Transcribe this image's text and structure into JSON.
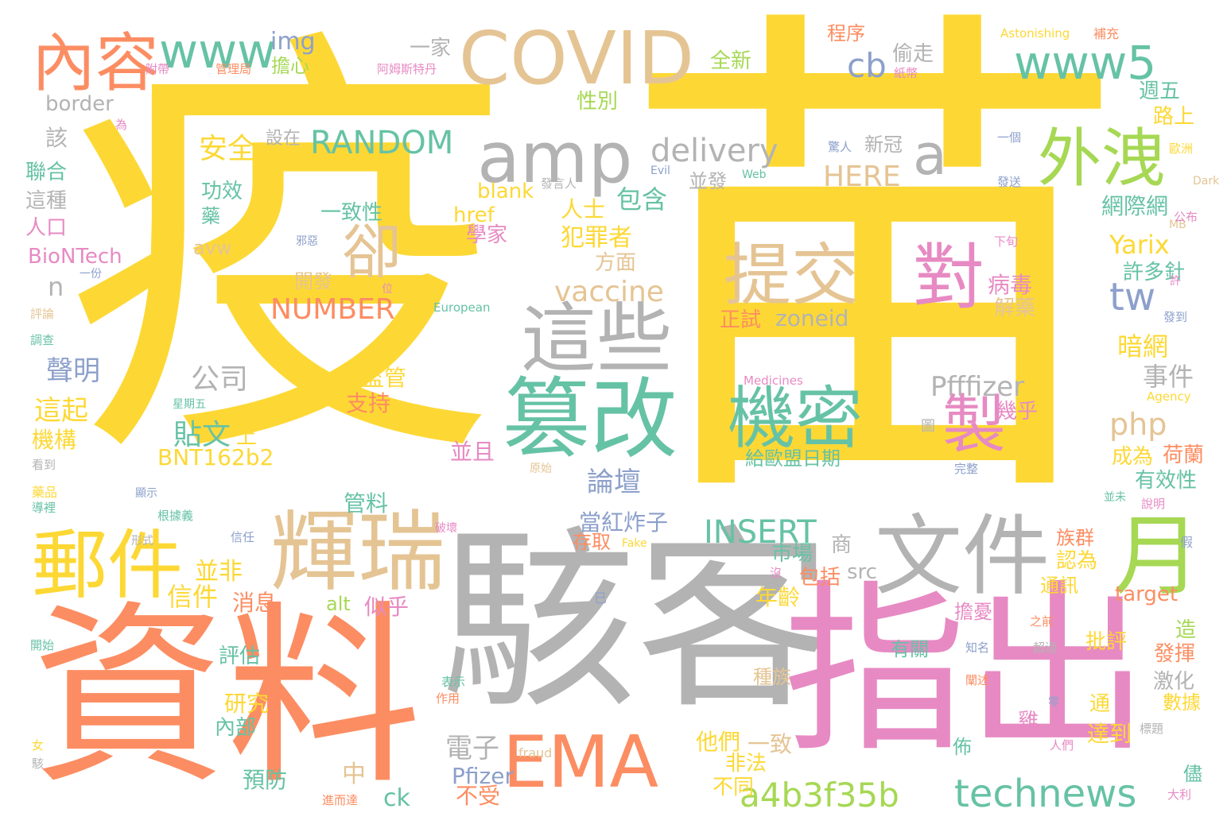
{
  "palette": {
    "yellow": "#FDD835",
    "orange": "#FC8D62",
    "gray": "#B3B3B3",
    "pink": "#E78AC3",
    "tan": "#E5C494",
    "green": "#66C2A5",
    "lime": "#A6D854",
    "blue": "#8DA0CB"
  },
  "words": [
    {
      "text": "疫",
      "color": "yellow"
    },
    {
      "text": "苗",
      "color": "yellow"
    },
    {
      "text": "資料",
      "color": "orange"
    },
    {
      "text": "駭客",
      "color": "gray"
    },
    {
      "text": "指出",
      "color": "pink"
    },
    {
      "text": "COVID",
      "color": "tan"
    },
    {
      "text": "EMA",
      "color": "orange"
    },
    {
      "text": "amp",
      "color": "gray"
    },
    {
      "text": "文件",
      "color": "gray"
    },
    {
      "text": "輝瑞",
      "color": "tan"
    },
    {
      "text": "篡改",
      "color": "green"
    },
    {
      "text": "這些",
      "color": "gray"
    },
    {
      "text": "郵件",
      "color": "yellow"
    },
    {
      "text": "內容",
      "color": "orange"
    },
    {
      "text": "www5",
      "color": "green"
    },
    {
      "text": "外洩",
      "color": "lime"
    },
    {
      "text": "月",
      "color": "lime"
    },
    {
      "text": "www",
      "color": "green"
    },
    {
      "text": "technews",
      "color": "green"
    },
    {
      "text": "a4b3f35b",
      "color": "lime"
    },
    {
      "text": "提交",
      "color": "tan"
    },
    {
      "text": "對",
      "color": "pink"
    },
    {
      "text": "機密",
      "color": "green"
    },
    {
      "text": "製",
      "color": "pink"
    },
    {
      "text": "卻",
      "color": "tan"
    },
    {
      "text": "RANDOM",
      "color": "green"
    },
    {
      "text": "delivery",
      "color": "gray"
    },
    {
      "text": "a",
      "color": "gray"
    },
    {
      "text": "cb",
      "color": "blue"
    },
    {
      "text": "tw",
      "color": "blue"
    },
    {
      "text": "NUMBER",
      "color": "orange"
    },
    {
      "text": "vaccine",
      "color": "tan"
    },
    {
      "text": "INSERT",
      "color": "green"
    },
    {
      "text": "Pfffizer",
      "color": "gray"
    },
    {
      "text": "php",
      "color": "tan"
    },
    {
      "text": "HERE",
      "color": "tan"
    },
    {
      "text": "Yarix",
      "color": "yellow"
    },
    {
      "text": "BNT162b2",
      "color": "yellow"
    },
    {
      "text": "zoneid",
      "color": "gray"
    },
    {
      "text": "blank",
      "color": "yellow"
    },
    {
      "text": "href",
      "color": "yellow"
    },
    {
      "text": "src",
      "color": "gray"
    },
    {
      "text": "alt",
      "color": "lime"
    },
    {
      "text": "target",
      "color": "orange"
    },
    {
      "text": "Pfizer",
      "color": "blue"
    },
    {
      "text": "ck",
      "color": "green"
    },
    {
      "text": "border",
      "color": "gray"
    },
    {
      "text": "img",
      "color": "blue"
    },
    {
      "text": "avw",
      "color": "tan"
    },
    {
      "text": "n",
      "color": "gray"
    },
    {
      "text": "BioNTech",
      "color": "pink"
    },
    {
      "text": "Astonishing",
      "color": "yellow"
    },
    {
      "text": "European",
      "color": "green"
    },
    {
      "text": "Medicines",
      "color": "pink"
    },
    {
      "text": "Agency",
      "color": "yellow"
    },
    {
      "text": "Web",
      "color": "green"
    },
    {
      "text": "Dark",
      "color": "tan"
    },
    {
      "text": "Evil",
      "color": "blue"
    },
    {
      "text": "MB",
      "color": "tan"
    },
    {
      "text": "Fake",
      "color": "yellow"
    },
    {
      "text": "fraud",
      "color": "tan"
    },
    {
      "text": "安全",
      "color": "yellow"
    },
    {
      "text": "外部",
      "color": "gray"
    },
    {
      "text": "聲明",
      "color": "blue"
    },
    {
      "text": "這起",
      "color": "yellow"
    },
    {
      "text": "機構",
      "color": "yellow"
    },
    {
      "text": "公司",
      "color": "gray"
    },
    {
      "text": "貼文",
      "color": "green"
    },
    {
      "text": "信件",
      "color": "yellow"
    },
    {
      "text": "並非",
      "color": "yellow"
    },
    {
      "text": "消息",
      "color": "orange"
    },
    {
      "text": "論壇",
      "color": "blue"
    },
    {
      "text": "當紅炸子",
      "color": "blue"
    },
    {
      "text": "市場",
      "color": "green"
    },
    {
      "text": "包括",
      "color": "orange"
    },
    {
      "text": "似乎",
      "color": "pink"
    },
    {
      "text": "年齡",
      "color": "yellow"
    },
    {
      "text": "評估",
      "color": "green"
    },
    {
      "text": "研究",
      "color": "yellow"
    },
    {
      "text": "內部",
      "color": "green"
    },
    {
      "text": "預防",
      "color": "green"
    },
    {
      "text": "電子",
      "color": "gray"
    },
    {
      "text": "不受",
      "color": "orange"
    },
    {
      "text": "他們",
      "color": "yellow"
    },
    {
      "text": "一致",
      "color": "tan"
    },
    {
      "text": "非法",
      "color": "yellow"
    },
    {
      "text": "不同",
      "color": "yellow"
    },
    {
      "text": "管料",
      "color": "green"
    },
    {
      "text": "存取",
      "color": "orange"
    },
    {
      "text": "支持",
      "color": "orange"
    },
    {
      "text": "監管",
      "color": "yellow"
    },
    {
      "text": "並且",
      "color": "pink"
    },
    {
      "text": "給歐盟日期",
      "color": "green"
    },
    {
      "text": "正試",
      "color": "orange"
    },
    {
      "text": "病毒",
      "color": "pink"
    },
    {
      "text": "解藥",
      "color": "tan"
    },
    {
      "text": "暗網",
      "color": "yellow"
    },
    {
      "text": "事件",
      "color": "gray"
    },
    {
      "text": "成為",
      "color": "yellow"
    },
    {
      "text": "荷蘭",
      "color": "orange"
    },
    {
      "text": "有效性",
      "color": "green"
    },
    {
      "text": "許多針",
      "color": "green"
    },
    {
      "text": "網際網",
      "color": "green"
    },
    {
      "text": "路上",
      "color": "yellow"
    },
    {
      "text": "週五",
      "color": "green"
    },
    {
      "text": "一家",
      "color": "gray"
    },
    {
      "text": "程序",
      "color": "orange"
    },
    {
      "text": "全新",
      "color": "lime"
    },
    {
      "text": "擔心",
      "color": "lime"
    },
    {
      "text": "偷走",
      "color": "gray"
    },
    {
      "text": "性別",
      "color": "lime"
    },
    {
      "text": "新冠",
      "color": "gray"
    },
    {
      "text": "並發",
      "color": "gray"
    },
    {
      "text": "包含",
      "color": "green"
    },
    {
      "text": "人士",
      "color": "yellow"
    },
    {
      "text": "犯罪者",
      "color": "yellow"
    },
    {
      "text": "方面",
      "color": "tan"
    },
    {
      "text": "學家",
      "color": "pink"
    },
    {
      "text": "功效",
      "color": "green"
    },
    {
      "text": "一致性",
      "color": "green"
    },
    {
      "text": "開發",
      "color": "tan"
    },
    {
      "text": "聯合",
      "color": "green"
    },
    {
      "text": "這種",
      "color": "gray"
    },
    {
      "text": "人口",
      "color": "pink"
    },
    {
      "text": "該",
      "color": "gray"
    },
    {
      "text": "設在",
      "color": "gray"
    },
    {
      "text": "族群",
      "color": "orange"
    },
    {
      "text": "認為",
      "color": "yellow"
    },
    {
      "text": "通訊",
      "color": "yellow"
    },
    {
      "text": "擔憂",
      "color": "pink"
    },
    {
      "text": "有關",
      "color": "green"
    },
    {
      "text": "批評",
      "color": "yellow"
    },
    {
      "text": "發揮",
      "color": "orange"
    },
    {
      "text": "激化",
      "color": "gray"
    },
    {
      "text": "數據",
      "color": "yellow"
    },
    {
      "text": "達到",
      "color": "yellow"
    },
    {
      "text": "種族",
      "color": "tan"
    },
    {
      "text": "幾乎",
      "color": "pink"
    },
    {
      "text": "報",
      "color": "yellow"
    },
    {
      "text": "都",
      "color": "yellow"
    },
    {
      "text": "上",
      "color": "yellow"
    },
    {
      "text": "中",
      "color": "tan"
    },
    {
      "text": "商",
      "color": "gray"
    },
    {
      "text": "造",
      "color": "lime"
    },
    {
      "text": "通",
      "color": "yellow"
    },
    {
      "text": "雞",
      "color": "pink"
    },
    {
      "text": "佈",
      "color": "green"
    },
    {
      "text": "儘",
      "color": "green"
    },
    {
      "text": "藥",
      "color": "green"
    },
    {
      "text": "阿姆斯特丹",
      "color": "pink"
    },
    {
      "text": "管理局",
      "color": "orange"
    },
    {
      "text": "附帶",
      "color": "pink"
    },
    {
      "text": "補充",
      "color": "orange"
    },
    {
      "text": "紙幣",
      "color": "pink"
    },
    {
      "text": "一個",
      "color": "blue"
    },
    {
      "text": "驚人",
      "color": "blue"
    },
    {
      "text": "歐洲",
      "color": "yellow"
    },
    {
      "text": "發送",
      "color": "blue"
    },
    {
      "text": "公布",
      "color": "pink"
    },
    {
      "text": "發言人",
      "color": "gray"
    },
    {
      "text": "下旬",
      "color": "pink"
    },
    {
      "text": "許",
      "color": "pink"
    },
    {
      "text": "發到",
      "color": "blue"
    },
    {
      "text": "一份",
      "color": "blue"
    },
    {
      "text": "評論",
      "color": "tan"
    },
    {
      "text": "調查",
      "color": "green"
    },
    {
      "text": "為",
      "color": "pink"
    },
    {
      "text": "位",
      "color": "pink"
    },
    {
      "text": "邪惡",
      "color": "blue"
    },
    {
      "text": "星期五",
      "color": "green"
    },
    {
      "text": "原始",
      "color": "tan"
    },
    {
      "text": "圖",
      "color": "gray"
    },
    {
      "text": "完整",
      "color": "blue"
    },
    {
      "text": "看到",
      "color": "gray"
    },
    {
      "text": "藥品",
      "color": "yellow"
    },
    {
      "text": "導裡",
      "color": "green"
    },
    {
      "text": "根據義",
      "color": "green"
    },
    {
      "text": "顯示",
      "color": "blue"
    },
    {
      "text": "形式",
      "color": "gray"
    },
    {
      "text": "信任",
      "color": "blue"
    },
    {
      "text": "破壞",
      "color": "pink"
    },
    {
      "text": "並未",
      "color": "green"
    },
    {
      "text": "說明",
      "color": "pink"
    },
    {
      "text": "假",
      "color": "blue"
    },
    {
      "text": "沒",
      "color": "pink"
    },
    {
      "text": "已",
      "color": "blue"
    },
    {
      "text": "開始",
      "color": "green"
    },
    {
      "text": "表示",
      "color": "green"
    },
    {
      "text": "作用",
      "color": "orange"
    },
    {
      "text": "之前",
      "color": "orange"
    },
    {
      "text": "知名",
      "color": "blue"
    },
    {
      "text": "超過",
      "color": "gray"
    },
    {
      "text": "闡述",
      "color": "orange"
    },
    {
      "text": "零",
      "color": "blue"
    },
    {
      "text": "人們",
      "color": "pink"
    },
    {
      "text": "標題",
      "color": "gray"
    },
    {
      "text": "女",
      "color": "yellow"
    },
    {
      "text": "駭",
      "color": "gray"
    },
    {
      "text": "進而達",
      "color": "orange"
    },
    {
      "text": "大利",
      "color": "pink"
    }
  ]
}
